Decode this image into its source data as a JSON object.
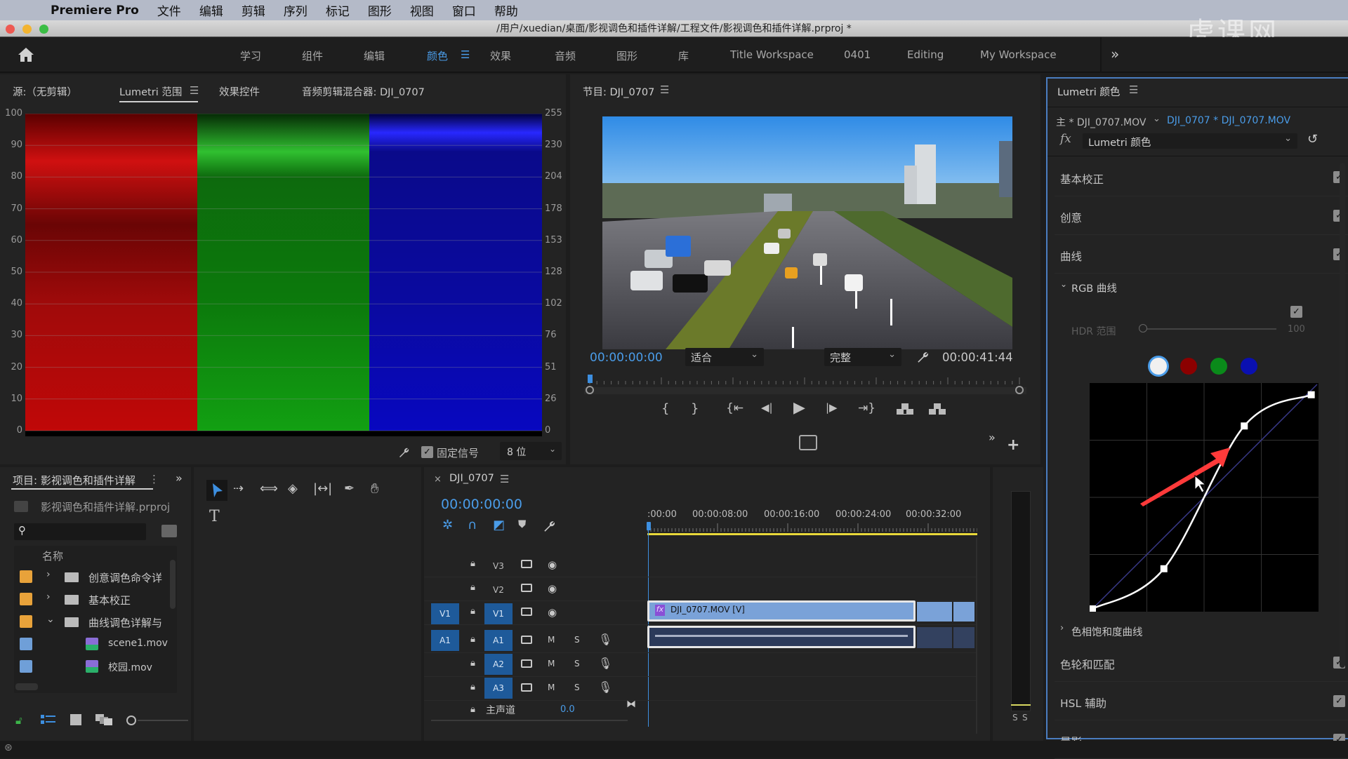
{
  "menubar": {
    "apple_icon": "apple-icon",
    "app_name": "Premiere Pro",
    "items": [
      "文件",
      "编辑",
      "剪辑",
      "序列",
      "标记",
      "图形",
      "视图",
      "窗口",
      "帮助"
    ]
  },
  "titlebar": {
    "path": "/用户/xuedian/桌面/影视调色和插件详解/工程文件/影视调色和插件详解.prproj *",
    "watermark": "虎课网"
  },
  "workspaces": {
    "items": [
      "学习",
      "组件",
      "编辑",
      "颜色",
      "效果",
      "音频",
      "图形",
      "库",
      "Title Workspace",
      "0401",
      "Editing",
      "My Workspace"
    ],
    "active": "颜色",
    "more": "»"
  },
  "source_panel": {
    "tabs": [
      "源:（无剪辑）",
      "Lumetri 范围",
      "效果控件",
      "音频剪辑混合器: DJI_0707"
    ],
    "active_tab": "Lumetri 范围",
    "scope": {
      "left_axis": [
        "100",
        "90",
        "80",
        "70",
        "60",
        "50",
        "40",
        "30",
        "20",
        "10",
        "0"
      ],
      "right_axis": [
        "255",
        "230",
        "204",
        "178",
        "153",
        "128",
        "102",
        "76",
        "51",
        "26",
        "0"
      ],
      "clamp_signal_label": "固定信号",
      "clamp_signal_checked": true,
      "bit_depth": "8 位"
    }
  },
  "program_monitor": {
    "title": "节目: DJI_0707",
    "timecode": "00:00:00:00",
    "zoom": "适合",
    "quality": "完整",
    "duration": "00:00:41:44",
    "playhead_fraction": 0.0
  },
  "project_panel": {
    "title": "项目: 影视调色和插件详解",
    "project_file": "影视调色和插件详解.prproj",
    "search_placeholder": "",
    "column_name": "名称",
    "items": [
      {
        "name": "创意调色命令详",
        "type": "folder",
        "expanded": false,
        "color": "#e8a23a",
        "indent": 0
      },
      {
        "name": "基本校正",
        "type": "folder",
        "expanded": false,
        "color": "#e8a23a",
        "indent": 0
      },
      {
        "name": "曲线调色详解与",
        "type": "folder",
        "expanded": true,
        "color": "#e8a23a",
        "indent": 0
      },
      {
        "name": "scene1.mov",
        "type": "clip",
        "color": "#6f9fd8",
        "indent": 1
      },
      {
        "name": "校园.mov",
        "type": "clip",
        "color": "#6f9fd8",
        "indent": 1
      }
    ]
  },
  "timeline": {
    "tab": "DJI_0707",
    "timecode": "00:00:00:00",
    "ruler": [
      ":00:00",
      "00:00:08:00",
      "00:00:16:00",
      "00:00:24:00",
      "00:00:32:00"
    ],
    "video_tracks": [
      "V3",
      "V2",
      "V1"
    ],
    "audio_tracks": [
      "A1",
      "A2",
      "A3"
    ],
    "source_patch_video": "V1",
    "source_patch_audio": "A1",
    "master_label": "主声道",
    "master_value": "0.0",
    "clip_video_label": "DJI_0707.MOV [V]",
    "mute_label": "M",
    "solo_label": "S"
  },
  "meters": {
    "labels": [
      "S",
      "S"
    ]
  },
  "lumetri": {
    "title": "Lumetri 颜色",
    "master_clip": "主 * DJI_0707.MOV",
    "sequence_clip": "DJI_0707 * DJI_0707.MOV",
    "effect": "Lumetri 颜色",
    "sections": [
      {
        "label": "基本校正",
        "checked": true
      },
      {
        "label": "创意",
        "checked": true
      },
      {
        "label": "曲线",
        "checked": true
      }
    ],
    "rgb_curves_label": "RGB 曲线",
    "rgb_curves_checked": true,
    "hdr_label": "HDR 范围",
    "hdr_value": "100",
    "hdr_fraction": 0.0,
    "channels": [
      {
        "name": "white",
        "color": "#f0f0f0",
        "selected": true
      },
      {
        "name": "red",
        "color": "#8b0000",
        "selected": false
      },
      {
        "name": "green",
        "color": "#0a8a1a",
        "selected": false
      },
      {
        "name": "blue",
        "color": "#0a10b0",
        "selected": false
      }
    ],
    "curve_points": [
      [
        0,
        0
      ],
      [
        0.32,
        0.18
      ],
      [
        0.68,
        0.82
      ],
      [
        0.98,
        0.96
      ]
    ],
    "hue_sat_label": "色相饱和度曲线",
    "sections_after": [
      {
        "label": "色轮和匹配",
        "checked": true
      },
      {
        "label": "HSL 辅助",
        "checked": true
      },
      {
        "label": "晕影",
        "checked": true
      }
    ],
    "accent": "#4a9ce8"
  }
}
